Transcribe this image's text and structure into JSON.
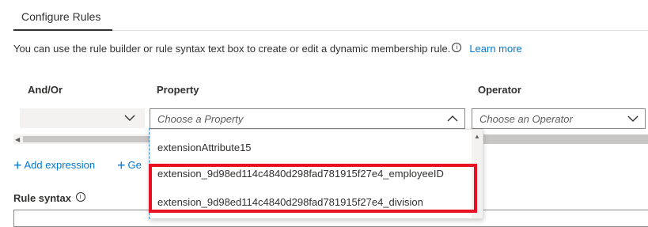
{
  "tabs": {
    "active": "Configure Rules"
  },
  "description": {
    "text": "You can use the rule builder or rule syntax text box to create or edit a dynamic membership rule.",
    "info_glyph": "i",
    "learn_more": "Learn more"
  },
  "columns": {
    "and_or": "And/Or",
    "property": "Property",
    "operator": "Operator"
  },
  "row": {
    "and_or_value": "",
    "property_placeholder": "Choose a Property",
    "operator_placeholder": "Choose an Operator"
  },
  "actions": {
    "add_expression": "Add expression",
    "get": "Ge"
  },
  "rule_syntax": {
    "label": "Rule syntax",
    "info_glyph": "i"
  },
  "property_options": [
    "extensionAttribute15",
    "extension_9d98ed114c4840d298fad781915f27e4_employeeID",
    "extension_9d98ed114c4840d298fad781915f27e4_division"
  ],
  "colors": {
    "highlight": "#e81123",
    "link": "#0078d4",
    "text": "#323130"
  },
  "icons": [
    "info-icon",
    "chevron-down-icon",
    "chevron-up-icon",
    "plus-icon",
    "scroll-left-icon",
    "scroll-up-icon"
  ]
}
